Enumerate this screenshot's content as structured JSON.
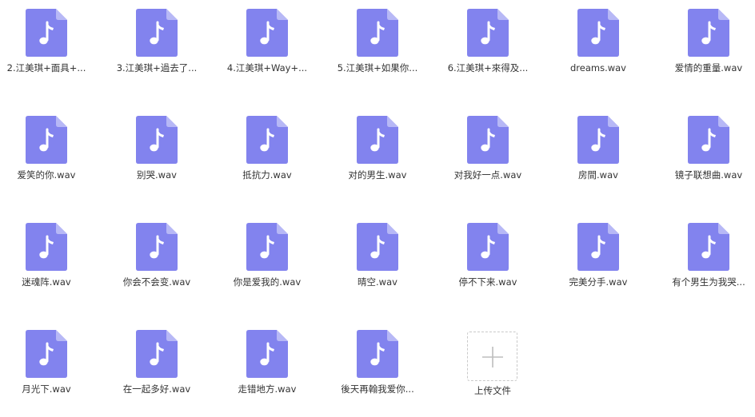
{
  "accent": "#8283ee",
  "files": [
    {
      "name": "2.江美琪+面具+...",
      "icon": "music-file-icon"
    },
    {
      "name": "3.江美琪+過去了...",
      "icon": "music-file-icon"
    },
    {
      "name": "4.江美琪+Way+...",
      "icon": "music-file-icon"
    },
    {
      "name": "5.江美琪+如果你...",
      "icon": "music-file-icon"
    },
    {
      "name": "6.江美琪+來得及...",
      "icon": "music-file-icon"
    },
    {
      "name": "dreams.wav",
      "icon": "music-file-icon"
    },
    {
      "name": "爱情的重量.wav",
      "icon": "music-file-icon"
    },
    {
      "name": "爱笑的你.wav",
      "icon": "music-file-icon"
    },
    {
      "name": "别哭.wav",
      "icon": "music-file-icon"
    },
    {
      "name": "抵抗力.wav",
      "icon": "music-file-icon"
    },
    {
      "name": "对的男生.wav",
      "icon": "music-file-icon"
    },
    {
      "name": "对我好一点.wav",
      "icon": "music-file-icon"
    },
    {
      "name": "房間.wav",
      "icon": "music-file-icon"
    },
    {
      "name": "镜子联想曲.wav",
      "icon": "music-file-icon"
    },
    {
      "name": "迷魂阵.wav",
      "icon": "music-file-icon"
    },
    {
      "name": "你会不会变.wav",
      "icon": "music-file-icon"
    },
    {
      "name": "你是爱我的.wav",
      "icon": "music-file-icon"
    },
    {
      "name": "晴空.wav",
      "icon": "music-file-icon"
    },
    {
      "name": "停不下来.wav",
      "icon": "music-file-icon"
    },
    {
      "name": "完美分手.wav",
      "icon": "music-file-icon"
    },
    {
      "name": "有个男生为我哭...",
      "icon": "music-file-icon"
    },
    {
      "name": "月光下.wav",
      "icon": "music-file-icon"
    },
    {
      "name": "在一起多好.wav",
      "icon": "music-file-icon"
    },
    {
      "name": "走错地方.wav",
      "icon": "music-file-icon"
    },
    {
      "name": "後天再翰我爱你...",
      "icon": "music-file-icon"
    }
  ],
  "upload": {
    "label": "上传文件",
    "icon": "plus-icon"
  }
}
